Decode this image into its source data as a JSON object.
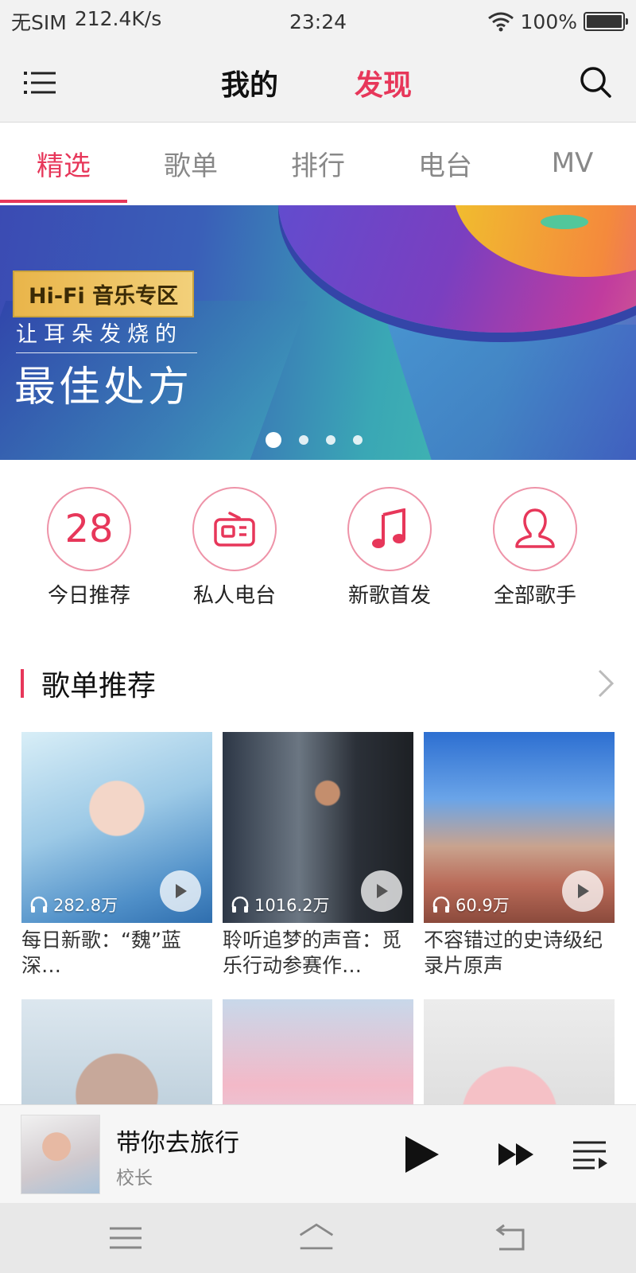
{
  "status": {
    "carrier": "无SIM",
    "speed": "212.4K/s",
    "time": "23:24",
    "battery": "100%"
  },
  "header": {
    "tab_mine": "我的",
    "tab_discover": "发现"
  },
  "subtabs": [
    "精选",
    "歌单",
    "排行",
    "电台",
    "MV"
  ],
  "banner": {
    "badge": "Hi-Fi 音乐专区",
    "subtitle": "让耳朵发烧的",
    "title": "最佳处方"
  },
  "quick": {
    "date_number": "28",
    "items": [
      "今日推荐",
      "私人电台",
      "新歌首发",
      "全部歌手"
    ]
  },
  "section": {
    "title": "歌单推荐"
  },
  "playlists": [
    {
      "count": "282.8万",
      "name": "每日新歌：“魏”蓝深…"
    },
    {
      "count": "1016.2万",
      "name": "聆听追梦的声音：觅乐行动参赛作…"
    },
    {
      "count": "60.9万",
      "name": "不容错过的史诗级纪录片原声"
    }
  ],
  "player": {
    "song": "带你去旅行",
    "artist": "校长"
  },
  "colors": {
    "accent": "#e7375a"
  }
}
